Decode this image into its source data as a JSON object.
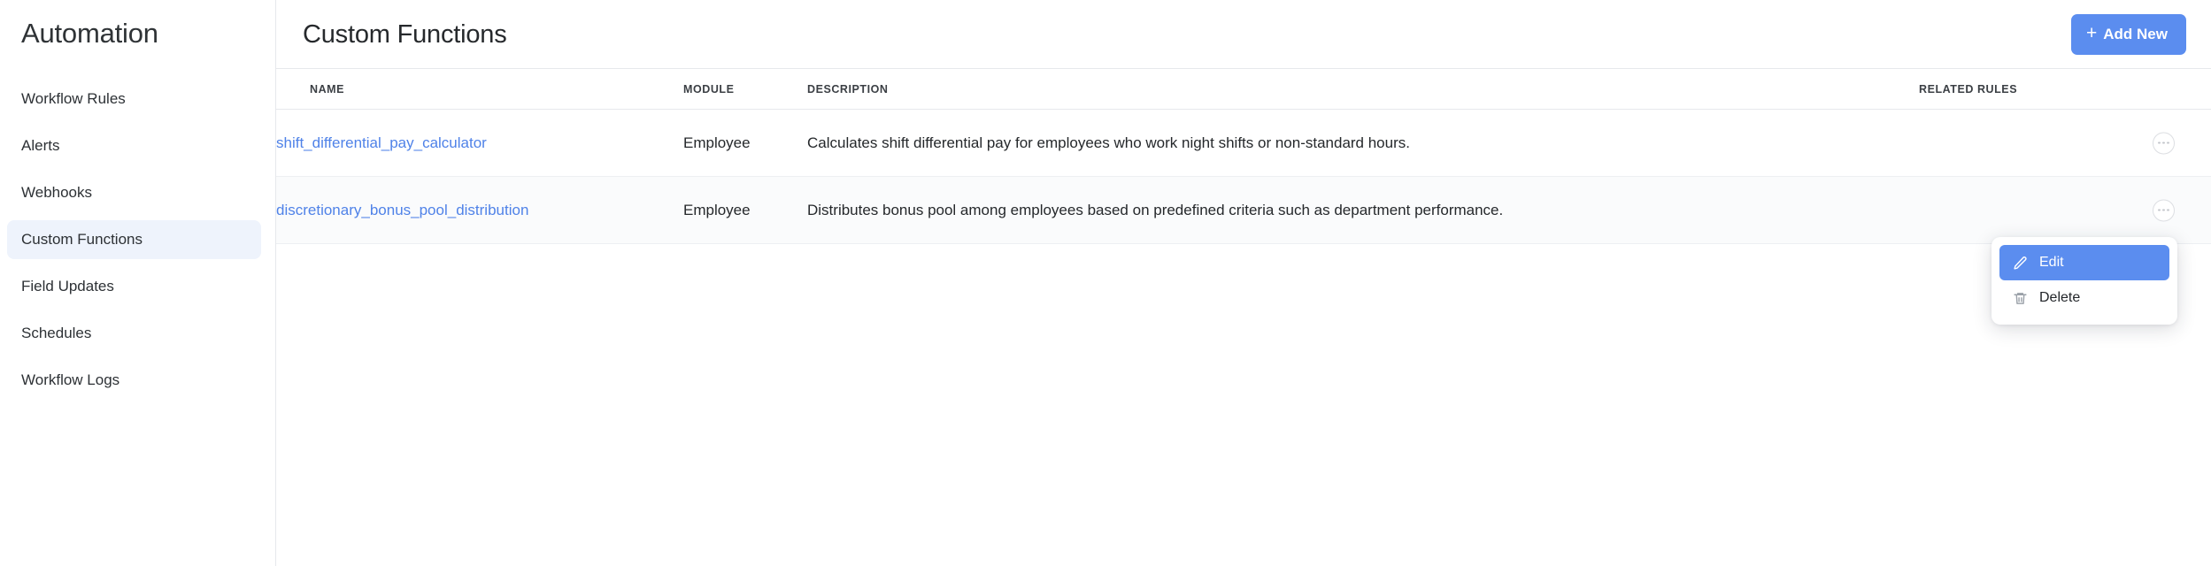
{
  "sidebar": {
    "title": "Automation",
    "items": [
      {
        "label": "Workflow Rules",
        "active": false
      },
      {
        "label": "Alerts",
        "active": false
      },
      {
        "label": "Webhooks",
        "active": false
      },
      {
        "label": "Custom Functions",
        "active": true
      },
      {
        "label": "Field Updates",
        "active": false
      },
      {
        "label": "Schedules",
        "active": false
      },
      {
        "label": "Workflow Logs",
        "active": false
      }
    ]
  },
  "header": {
    "title": "Custom Functions",
    "add_new_label": "Add New",
    "add_new_plus": "+",
    "add_new_icon": "plus-icon"
  },
  "table": {
    "columns": [
      {
        "key": "name",
        "label": "NAME"
      },
      {
        "key": "module",
        "label": "MODULE"
      },
      {
        "key": "description",
        "label": "DESCRIPTION"
      },
      {
        "key": "related_rules",
        "label": "RELATED RULES"
      }
    ],
    "rows": [
      {
        "name": "shift_differential_pay_calculator",
        "module": "Employee",
        "description": "Calculates shift differential pay for employees who work night shifts or non-standard hours.",
        "related_rules": "",
        "action_icon": "more-options-icon"
      },
      {
        "name": "discretionary_bonus_pool_distribution",
        "module": "Employee",
        "description": "Distributes bonus pool among employees based on predefined criteria such as department performance.",
        "related_rules": "",
        "action_icon": "more-options-icon"
      }
    ]
  },
  "context_menu": {
    "visible": true,
    "items": [
      {
        "label": "Edit",
        "icon": "pencil-icon",
        "selected": true
      },
      {
        "label": "Delete",
        "icon": "trash-icon",
        "selected": false
      }
    ]
  },
  "colors": {
    "accent": "#5b8def",
    "link": "#4f82e8",
    "sidebar_active_bg": "#eef3fc",
    "row_hover_bg": "#fafbfc",
    "border": "#e6e8ec",
    "text": "#25282b"
  }
}
